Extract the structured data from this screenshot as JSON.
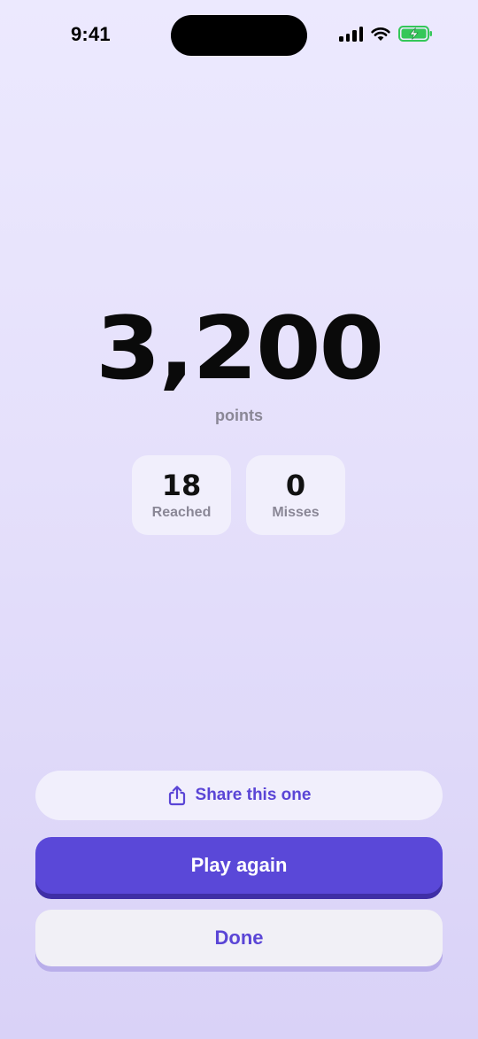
{
  "status_bar": {
    "time": "9:41",
    "icons": [
      "signal-icon",
      "wifi-icon",
      "battery-charging-icon"
    ],
    "battery_color": "#34C759"
  },
  "result": {
    "score": "3,200",
    "score_label": "points",
    "stats": [
      {
        "value": "18",
        "label": "Reached"
      },
      {
        "value": "0",
        "label": "Misses"
      }
    ]
  },
  "actions": {
    "share_label": "Share this one",
    "share_icon": "share-icon",
    "play_again_label": "Play again",
    "done_label": "Done"
  },
  "colors": {
    "accent": "#5A48D8",
    "accent_shadow": "#3F2FA6",
    "background_top": "#ECE9FE",
    "background_bottom": "#D9D2F7"
  }
}
